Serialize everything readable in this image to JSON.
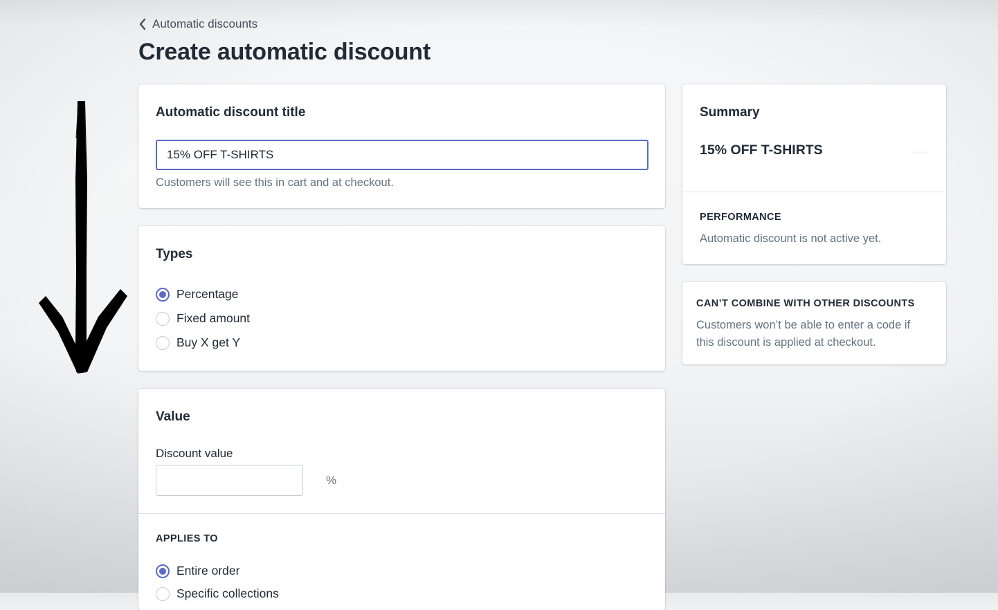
{
  "breadcrumb": {
    "label": "Automatic discounts"
  },
  "page": {
    "title": "Create automatic discount"
  },
  "title_card": {
    "heading": "Automatic discount title",
    "input_value": "15% OFF T-SHIRTS",
    "help": "Customers will see this in cart and at checkout."
  },
  "types_card": {
    "heading": "Types",
    "options": [
      "Percentage",
      "Fixed amount",
      "Buy X get Y"
    ],
    "selected": "Percentage"
  },
  "value_card": {
    "heading": "Value",
    "discount_value_label": "Discount value",
    "discount_value": "",
    "suffix": "%",
    "applies_to_heading": "APPLIES TO",
    "applies_to_options": [
      "Entire order",
      "Specific collections"
    ],
    "applies_to_selected": "Entire order"
  },
  "summary": {
    "heading": "Summary",
    "discount_name": "15% OFF T-SHIRTS",
    "performance_heading": "PERFORMANCE",
    "performance_text": "Automatic discount is not active yet."
  },
  "combine_card": {
    "heading": "CAN’T COMBINE WITH OTHER DISCOUNTS",
    "text_line1": "Customers won’t be able to enter a code if",
    "text_line2": "this discount is applied at checkout."
  },
  "colors": {
    "accent": "#5c6ac4",
    "text": "#212b36",
    "muted": "#637381",
    "border": "#c4cdd5",
    "arrow": "#000000"
  },
  "icons": [
    "chevron-left-icon",
    "down-arrow-annotation-icon"
  ]
}
